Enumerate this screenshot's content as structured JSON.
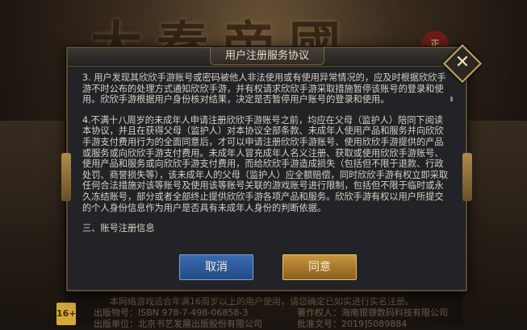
{
  "background": {
    "title_art": "大秦帝國",
    "badge": "正"
  },
  "dialog": {
    "title": "用户注册服务协议",
    "paragraphs": [
      "3. 用户发现其欣欣手游账号或密码被他人非法使用或有使用异常情况的，应及时根据欣欣手游不时公布的处理方式通知欣欣手游，并有权请求欣欣手游采取措施暂停该账号的登录和使用。欣欣手游根据用户身份核对结果，决定是否暂停用户账号的登录和使用。",
      "4.不满十八周岁的未成年人申请注册欣欣手游账号之前，均应在父母（监护人）陪同下阅读本协议，并且在获得父母（监护人）对本协议全部条款、未成年人使用产品和服务并向欣欣手游支付费用行为的全面同意后，才可以申请注册欣欣手游账号、使用欣欣手游提供的产品或服务或向欣欣手游支付费用。未成年人冒充成年人名义注册、获取或使用欣欣手游账号、使用产品和服务或向欣欣手游支付费用，而给欣欣手游造成损失（包括但不限于退款、行政处罚、商誉损失等），该未成年人的父母（监护人）应全额赔偿，同时欣欣手游有权立即采取任何合法措施对该等账号及使用该等账号关联的游戏账号进行限制，包括但不限于临时或永久冻结账号，部分或者全部终止提供欣欣手游各项产品和服务。欣欣手游有权以用户所提交的个人身份信息作为用户是否具有未成年人身份的判断依据。",
      "三、账号注册信息"
    ],
    "cancel_label": "取消",
    "ok_label": "同意"
  },
  "footer": {
    "line1": "本网络游戏适合年满16周岁以上的用户使用，请您确定已如实进行实名注册。",
    "publish_no": "出版物号：ISBN 978-7-498-06858-3",
    "copyright": "著作权人：海南银镖数码科技有限公司",
    "line3": "出版单位：北京书艺发展出版股份有限公司",
    "line3_right": "批准文号：2019]5089884",
    "age_badge": "16+"
  }
}
